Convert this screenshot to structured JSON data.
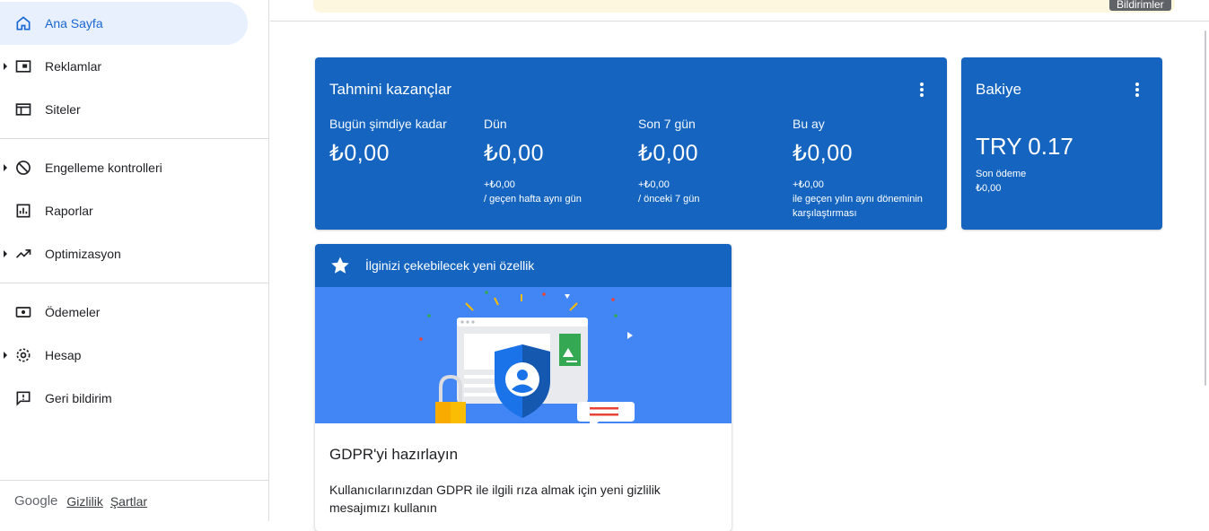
{
  "sidebar": {
    "items": [
      {
        "label": "Ana Sayfa"
      },
      {
        "label": "Reklamlar"
      },
      {
        "label": "Siteler"
      },
      {
        "label": "Engelleme kontrolleri"
      },
      {
        "label": "Raporlar"
      },
      {
        "label": "Optimizasyon"
      },
      {
        "label": "Ödemeler"
      },
      {
        "label": "Hesap"
      },
      {
        "label": "Geri bildirim"
      }
    ],
    "footer": {
      "brand": "Google",
      "privacy": "Gizlilik",
      "terms": "Şartlar"
    }
  },
  "topbar": {
    "tooltip": "Bildirimler"
  },
  "earnings": {
    "title": "Tahmini kazançlar",
    "metrics": [
      {
        "label": "Bugün şimdiye kadar",
        "value": "₺0,00",
        "delta": "",
        "delta_note": ""
      },
      {
        "label": "Dün",
        "value": "₺0,00",
        "delta": "+₺0,00",
        "delta_note": "/ geçen hafta aynı gün"
      },
      {
        "label": "Son 7 gün",
        "value": "₺0,00",
        "delta": "+₺0,00",
        "delta_note": "/ önceki 7 gün"
      },
      {
        "label": "Bu ay",
        "value": "₺0,00",
        "delta": "+₺0,00",
        "delta_note": "ile geçen yılın aynı döneminin karşılaştırması"
      }
    ]
  },
  "balance": {
    "title": "Bakiye",
    "value": "TRY 0.17",
    "last_payment_label": "Son ödeme",
    "last_payment_value": "₺0,00"
  },
  "feature": {
    "header": "İlginizi çekebilecek yeni özellik",
    "title": "GDPR'yi hazırlayın",
    "description": "Kullanıcılarınızdan GDPR ile ilgili rıza almak için yeni gizlilik mesajımızı kullanın"
  },
  "colors": {
    "card": "#1565c0",
    "active_nav": "#e8f0fe",
    "accent": "#1967d2"
  }
}
